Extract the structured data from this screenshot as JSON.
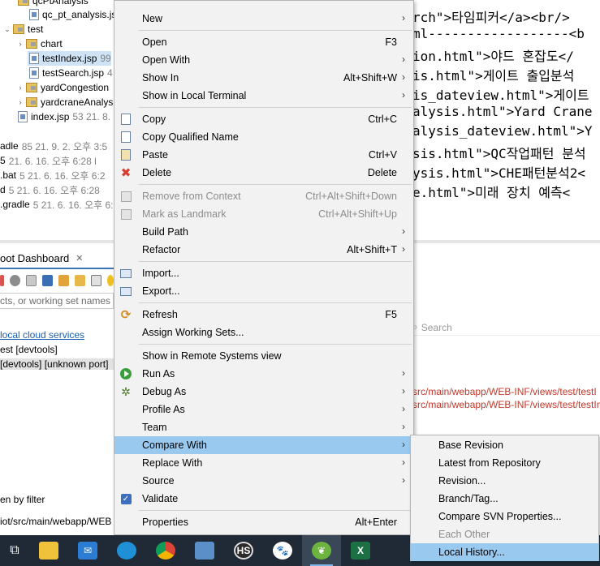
{
  "tree": {
    "rows": [
      {
        "name": "qcPtAnalysis",
        "meta": ""
      },
      {
        "name": "qc_pt_analysis.jsp",
        "meta": ""
      },
      {
        "name": "test",
        "meta": ""
      },
      {
        "name": "chart",
        "meta": ""
      },
      {
        "name": "testIndex.jsp",
        "meta": "99"
      },
      {
        "name": "testSearch.jsp",
        "meta": "4"
      },
      {
        "name": "yardCongestion",
        "meta": ""
      },
      {
        "name": "yardcraneAnalysis",
        "meta": ""
      },
      {
        "name": "index.jsp",
        "meta": "53  21. 8."
      },
      {
        "name": "adle",
        "meta": "85  21. 9. 2. 오후 3:5"
      },
      {
        "name": "5",
        "meta": "21. 6. 16. 오후 6:28  l"
      },
      {
        "name": ".bat",
        "meta": "5  21. 6. 16. 오후 6:2"
      },
      {
        "name": "d",
        "meta": "5  21. 6. 16. 오후 6:28"
      },
      {
        "name": ".gradle",
        "meta": "5  21. 6. 16. 오후 6:"
      }
    ]
  },
  "bottom_panel": {
    "tab_title": "oot Dashboard",
    "filter_placeholder": "cts, or working set names",
    "cloud_link": "local cloud services",
    "item1": "est [devtools]",
    "item2": "[devtools] [unknown port]",
    "hidden_filter": "en by filter",
    "path": "iot/src/main/webapp/WEB"
  },
  "editor": {
    "lines": [
      "rch\">타임피커</a><br/>",
      "ml------------------<b",
      "ion.html\">야드 혼잡도</",
      "is.html\">게이트 출입분석",
      "is_dateview.html\">게이트",
      "alysis.html\">Yard Crane",
      "alysis_dateview.html\">Y",
      "sis.html\">QC작업패턴 분석",
      "ysis.html\">CHE패턴분석2<",
      "e.html\">미래 장치 예측<"
    ],
    "search_placeholder": "Search",
    "path1": "src/main/webapp/WEB-INF/views/test/testI",
    "path2": "src/main/webapp/WEB-INF/views/test/testIn"
  },
  "context_menu": {
    "items": [
      {
        "label": "New",
        "shortcut": "",
        "submenu": true
      },
      {
        "label": "Open",
        "shortcut": "F3",
        "submenu": false
      },
      {
        "label": "Open With",
        "shortcut": "",
        "submenu": true
      },
      {
        "label": "Show In",
        "shortcut": "Alt+Shift+W",
        "submenu": true
      },
      {
        "label": "Show in Local Terminal",
        "shortcut": "",
        "submenu": true
      },
      {
        "label": "Copy",
        "shortcut": "Ctrl+C",
        "submenu": false
      },
      {
        "label": "Copy Qualified Name",
        "shortcut": "",
        "submenu": false
      },
      {
        "label": "Paste",
        "shortcut": "Ctrl+V",
        "submenu": false
      },
      {
        "label": "Delete",
        "shortcut": "Delete",
        "submenu": false
      },
      {
        "label": "Remove from Context",
        "shortcut": "Ctrl+Alt+Shift+Down",
        "submenu": false
      },
      {
        "label": "Mark as Landmark",
        "shortcut": "Ctrl+Alt+Shift+Up",
        "submenu": false
      },
      {
        "label": "Build Path",
        "shortcut": "",
        "submenu": true
      },
      {
        "label": "Refactor",
        "shortcut": "Alt+Shift+T",
        "submenu": true
      },
      {
        "label": "Import...",
        "shortcut": "",
        "submenu": false
      },
      {
        "label": "Export...",
        "shortcut": "",
        "submenu": false
      },
      {
        "label": "Refresh",
        "shortcut": "F5",
        "submenu": false
      },
      {
        "label": "Assign Working Sets...",
        "shortcut": "",
        "submenu": false
      },
      {
        "label": "Show in Remote Systems view",
        "shortcut": "",
        "submenu": false
      },
      {
        "label": "Run As",
        "shortcut": "",
        "submenu": true
      },
      {
        "label": "Debug As",
        "shortcut": "",
        "submenu": true
      },
      {
        "label": "Profile As",
        "shortcut": "",
        "submenu": true
      },
      {
        "label": "Team",
        "shortcut": "",
        "submenu": true
      },
      {
        "label": "Compare With",
        "shortcut": "",
        "submenu": true
      },
      {
        "label": "Replace With",
        "shortcut": "",
        "submenu": true
      },
      {
        "label": "Source",
        "shortcut": "",
        "submenu": true
      },
      {
        "label": "Validate",
        "shortcut": "",
        "submenu": false
      },
      {
        "label": "Properties",
        "shortcut": "Alt+Enter",
        "submenu": false
      }
    ]
  },
  "compare_submenu": {
    "items": [
      {
        "label": "Base Revision"
      },
      {
        "label": "Latest from Repository"
      },
      {
        "label": "Revision..."
      },
      {
        "label": "Branch/Tag..."
      },
      {
        "label": "Compare SVN Properties..."
      },
      {
        "label": "Each Other"
      },
      {
        "label": "Local History..."
      }
    ]
  },
  "taskbar": {
    "apps": [
      "task-view",
      "file-explorer",
      "mail",
      "edge",
      "chrome",
      "laptop-app",
      "hs-app",
      "puppy-app",
      "spring-tool-suite",
      "excel"
    ],
    "hs_label": "HS",
    "excel_label": "X"
  },
  "colors": {
    "menu_bg": "#f2f2f2",
    "highlight": "#99c9ef",
    "taskbar": "#1f2a36",
    "path_red": "#c0392b"
  }
}
